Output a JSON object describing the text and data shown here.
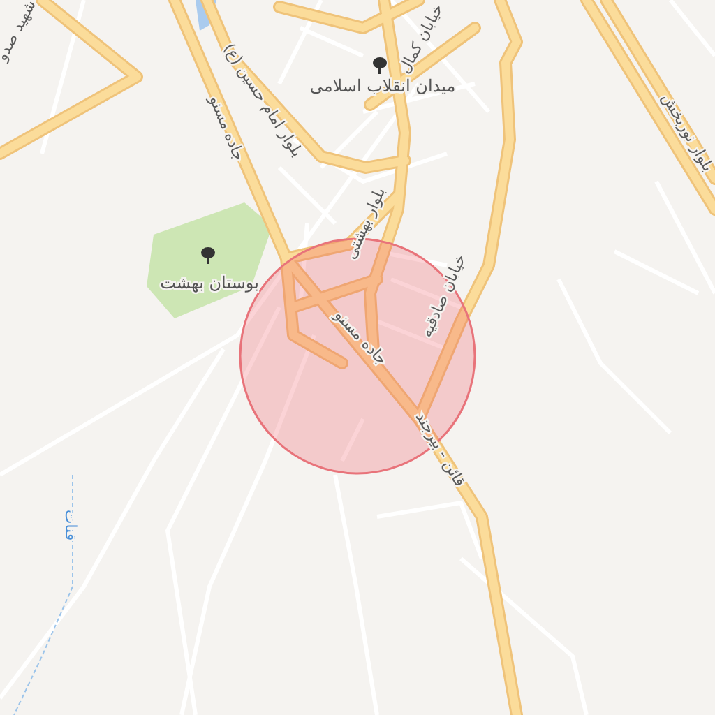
{
  "map": {
    "labels": [
      {
        "kind": "place",
        "text": "میدان انقلاب اسلامی"
      },
      {
        "kind": "park",
        "text": "بوستان بهشت"
      },
      {
        "kind": "street",
        "text": "جاده مسنو"
      },
      {
        "kind": "street",
        "text": "بلوار امام حسین (ع)"
      },
      {
        "kind": "street",
        "text": "خیابان کمال"
      },
      {
        "kind": "street",
        "text": "بلوار بهشتی"
      },
      {
        "kind": "street",
        "text": "جاده مسنو"
      },
      {
        "kind": "street",
        "text": "خیابان صادقیه"
      },
      {
        "kind": "street",
        "text": "قائن - بیرجند"
      },
      {
        "kind": "street",
        "text": "بلوار نوربخش"
      },
      {
        "kind": "water",
        "text": "قنات"
      },
      {
        "kind": "street",
        "text": "شهید صدو"
      }
    ]
  }
}
